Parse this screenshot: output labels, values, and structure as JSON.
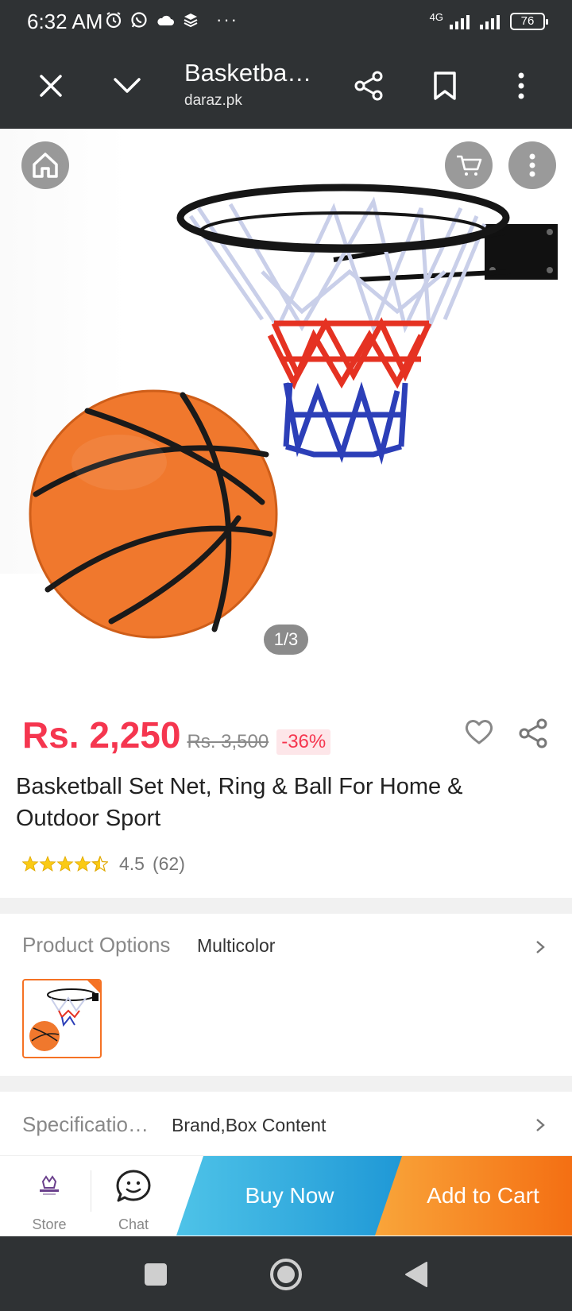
{
  "status_bar": {
    "time": "6:32 AM",
    "network": "4G",
    "battery": "76",
    "more": "···"
  },
  "toolbar": {
    "title": "Basketba…",
    "url": "daraz.pk"
  },
  "product_image": {
    "pager": "1/3"
  },
  "product": {
    "price": "Rs. 2,250",
    "old_price": "Rs. 3,500",
    "discount": "-36%",
    "title": "Basketball Set Net, Ring & Ball For Home & Outdoor Sport",
    "rating_value": "4.5",
    "rating_count": "(62)",
    "rating_stars": 4.5
  },
  "options": {
    "label": "Product Options",
    "value": "Multicolor"
  },
  "specifications": {
    "label": "Specificatio…",
    "value": "Brand,Box Content"
  },
  "bottom_bar": {
    "store_label": "Store",
    "chat_label": "Chat",
    "buy_now_label": "Buy Now",
    "add_to_cart_label": "Add to Cart"
  },
  "colors": {
    "price": "#f5364f",
    "accent_orange": "#f57224",
    "buy_now": "#1f98d6",
    "bar_dark": "#2f3234"
  }
}
